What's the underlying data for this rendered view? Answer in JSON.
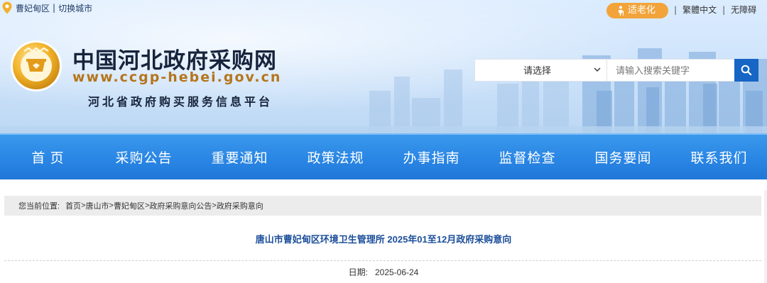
{
  "location": {
    "current_region": "曹妃甸区",
    "separator": "|",
    "switch_label": "切换城市"
  },
  "top_links": {
    "elder_mode": "适老化",
    "traditional": "繁體中文",
    "accessibility": "无障碍",
    "separator": "|"
  },
  "brand": {
    "title": "中国河北政府采购网",
    "url": "www.ccgp-hebei.gov.cn",
    "subtitle": "河北省政府购买服务信息平台"
  },
  "search": {
    "select_value": "请选择",
    "placeholder": "请输入搜索关键字",
    "button_icon": "search-icon"
  },
  "nav": {
    "items": [
      {
        "label": "首  页"
      },
      {
        "label": "采购公告"
      },
      {
        "label": "重要通知"
      },
      {
        "label": "政策法规"
      },
      {
        "label": "办事指南"
      },
      {
        "label": "监督检查"
      },
      {
        "label": "国务要闻"
      },
      {
        "label": "联系我们"
      }
    ]
  },
  "breadcrumb": {
    "label": "您当前位置:",
    "items": [
      "首页",
      "唐山市",
      "曹妃甸区",
      "政府采购意向公告",
      "政府采购意向"
    ],
    "separator": ">"
  },
  "article": {
    "title": "唐山市曹妃甸区环境卫生管理所 2025年01至12月政府采购意向",
    "date_label": "日期:",
    "date_value": "2025-06-24"
  },
  "colors": {
    "nav_blue": "#2a86e4",
    "elder_orange": "#f2a43a",
    "title_blue": "#1b4e9a",
    "search_button": "#1765c4"
  }
}
